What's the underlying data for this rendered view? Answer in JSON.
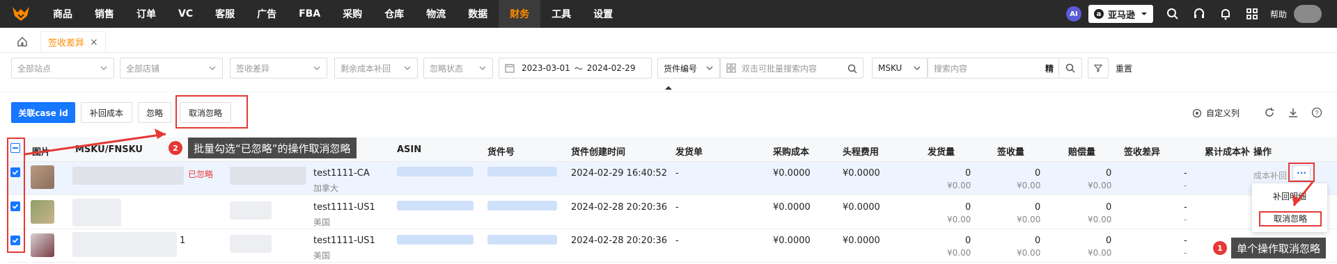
{
  "nav": {
    "items": [
      "商品",
      "销售",
      "订单",
      "VC",
      "客服",
      "广告",
      "FBA",
      "采购",
      "仓库",
      "物流",
      "数据",
      "财务",
      "工具",
      "设置"
    ],
    "active_index": 11,
    "ai": "AI",
    "store": "亚马逊",
    "help": "帮助"
  },
  "tabs": {
    "current": "签收差异",
    "close": "×"
  },
  "filters": {
    "site": "全部站点",
    "shop": "全部店铺",
    "diff": "签收差异",
    "remain": "剩余成本补回",
    "ignore": "忽略状态",
    "date_start": "2023-03-01",
    "date_sep": "～",
    "date_end": "2024-02-29",
    "cargo_no": "货件编号",
    "search_ph": "双击可批量搜索内容",
    "msku": "MSKU",
    "content_ph": "搜索内容",
    "precise": "精",
    "reset": "重置"
  },
  "toolbar": {
    "link_case": "关联case id",
    "reclaim": "补回成本",
    "ignore": "忽略",
    "unignore": "取消忽略",
    "custom_cols": "自定义列"
  },
  "columns": [
    "图片",
    "MSKU/FNSKU",
    "ASIN",
    "货件号",
    "货件创建时间",
    "发货单",
    "采购成本",
    "头程费用",
    "发货量",
    "签收量",
    "赔偿量",
    "签收差异",
    "累计成本补",
    "操作"
  ],
  "rows": [
    {
      "shipment": "test1111-CA",
      "country": "加拿大",
      "time": "2024-02-29 16:40:52",
      "invoice": "-",
      "cost": "¥0.0000",
      "freight": "¥0.0000",
      "ship_qty": "0",
      "ship_amt": "¥0.00",
      "recv_qty": "0",
      "recv_amt": "¥0.00",
      "comp_qty": "0",
      "comp_amt": "¥0.00",
      "diff": "-",
      "diff2": "-",
      "status": "已忽略"
    },
    {
      "shipment": "test1111-US1",
      "country": "美国",
      "time": "2024-02-28 20:20:36",
      "invoice": "-",
      "cost": "¥0.0000",
      "freight": "¥0.0000",
      "ship_qty": "0",
      "ship_amt": "¥0.00",
      "recv_qty": "0",
      "recv_amt": "¥0.00",
      "comp_qty": "0",
      "comp_amt": "¥0.00",
      "diff": "-",
      "diff2": "-"
    },
    {
      "shipment": "test1111-US1",
      "country": "美国",
      "time": "2024-02-28 20:20:36",
      "invoice": "-",
      "cost": "¥0.0000",
      "freight": "¥0.0000",
      "ship_qty": "0",
      "ship_amt": "¥0.00",
      "recv_qty": "0",
      "recv_amt": "¥0.00",
      "comp_qty": "0",
      "comp_amt": "¥0.00",
      "diff": "-",
      "diff2": "-"
    }
  ],
  "ops": {
    "reclaim_cost": "成本补回",
    "more": "···",
    "menu_detail": "补回明细",
    "menu_unignore": "取消忽略"
  },
  "annotations": {
    "batch": "批量勾选“已忽略”的操作取消忽略",
    "single": "单个操作取消忽略",
    "n1": "1",
    "n2": "2"
  },
  "colors": {
    "accent": "#ff8a00",
    "primary": "#1677ff",
    "highlight": "#e53935"
  }
}
